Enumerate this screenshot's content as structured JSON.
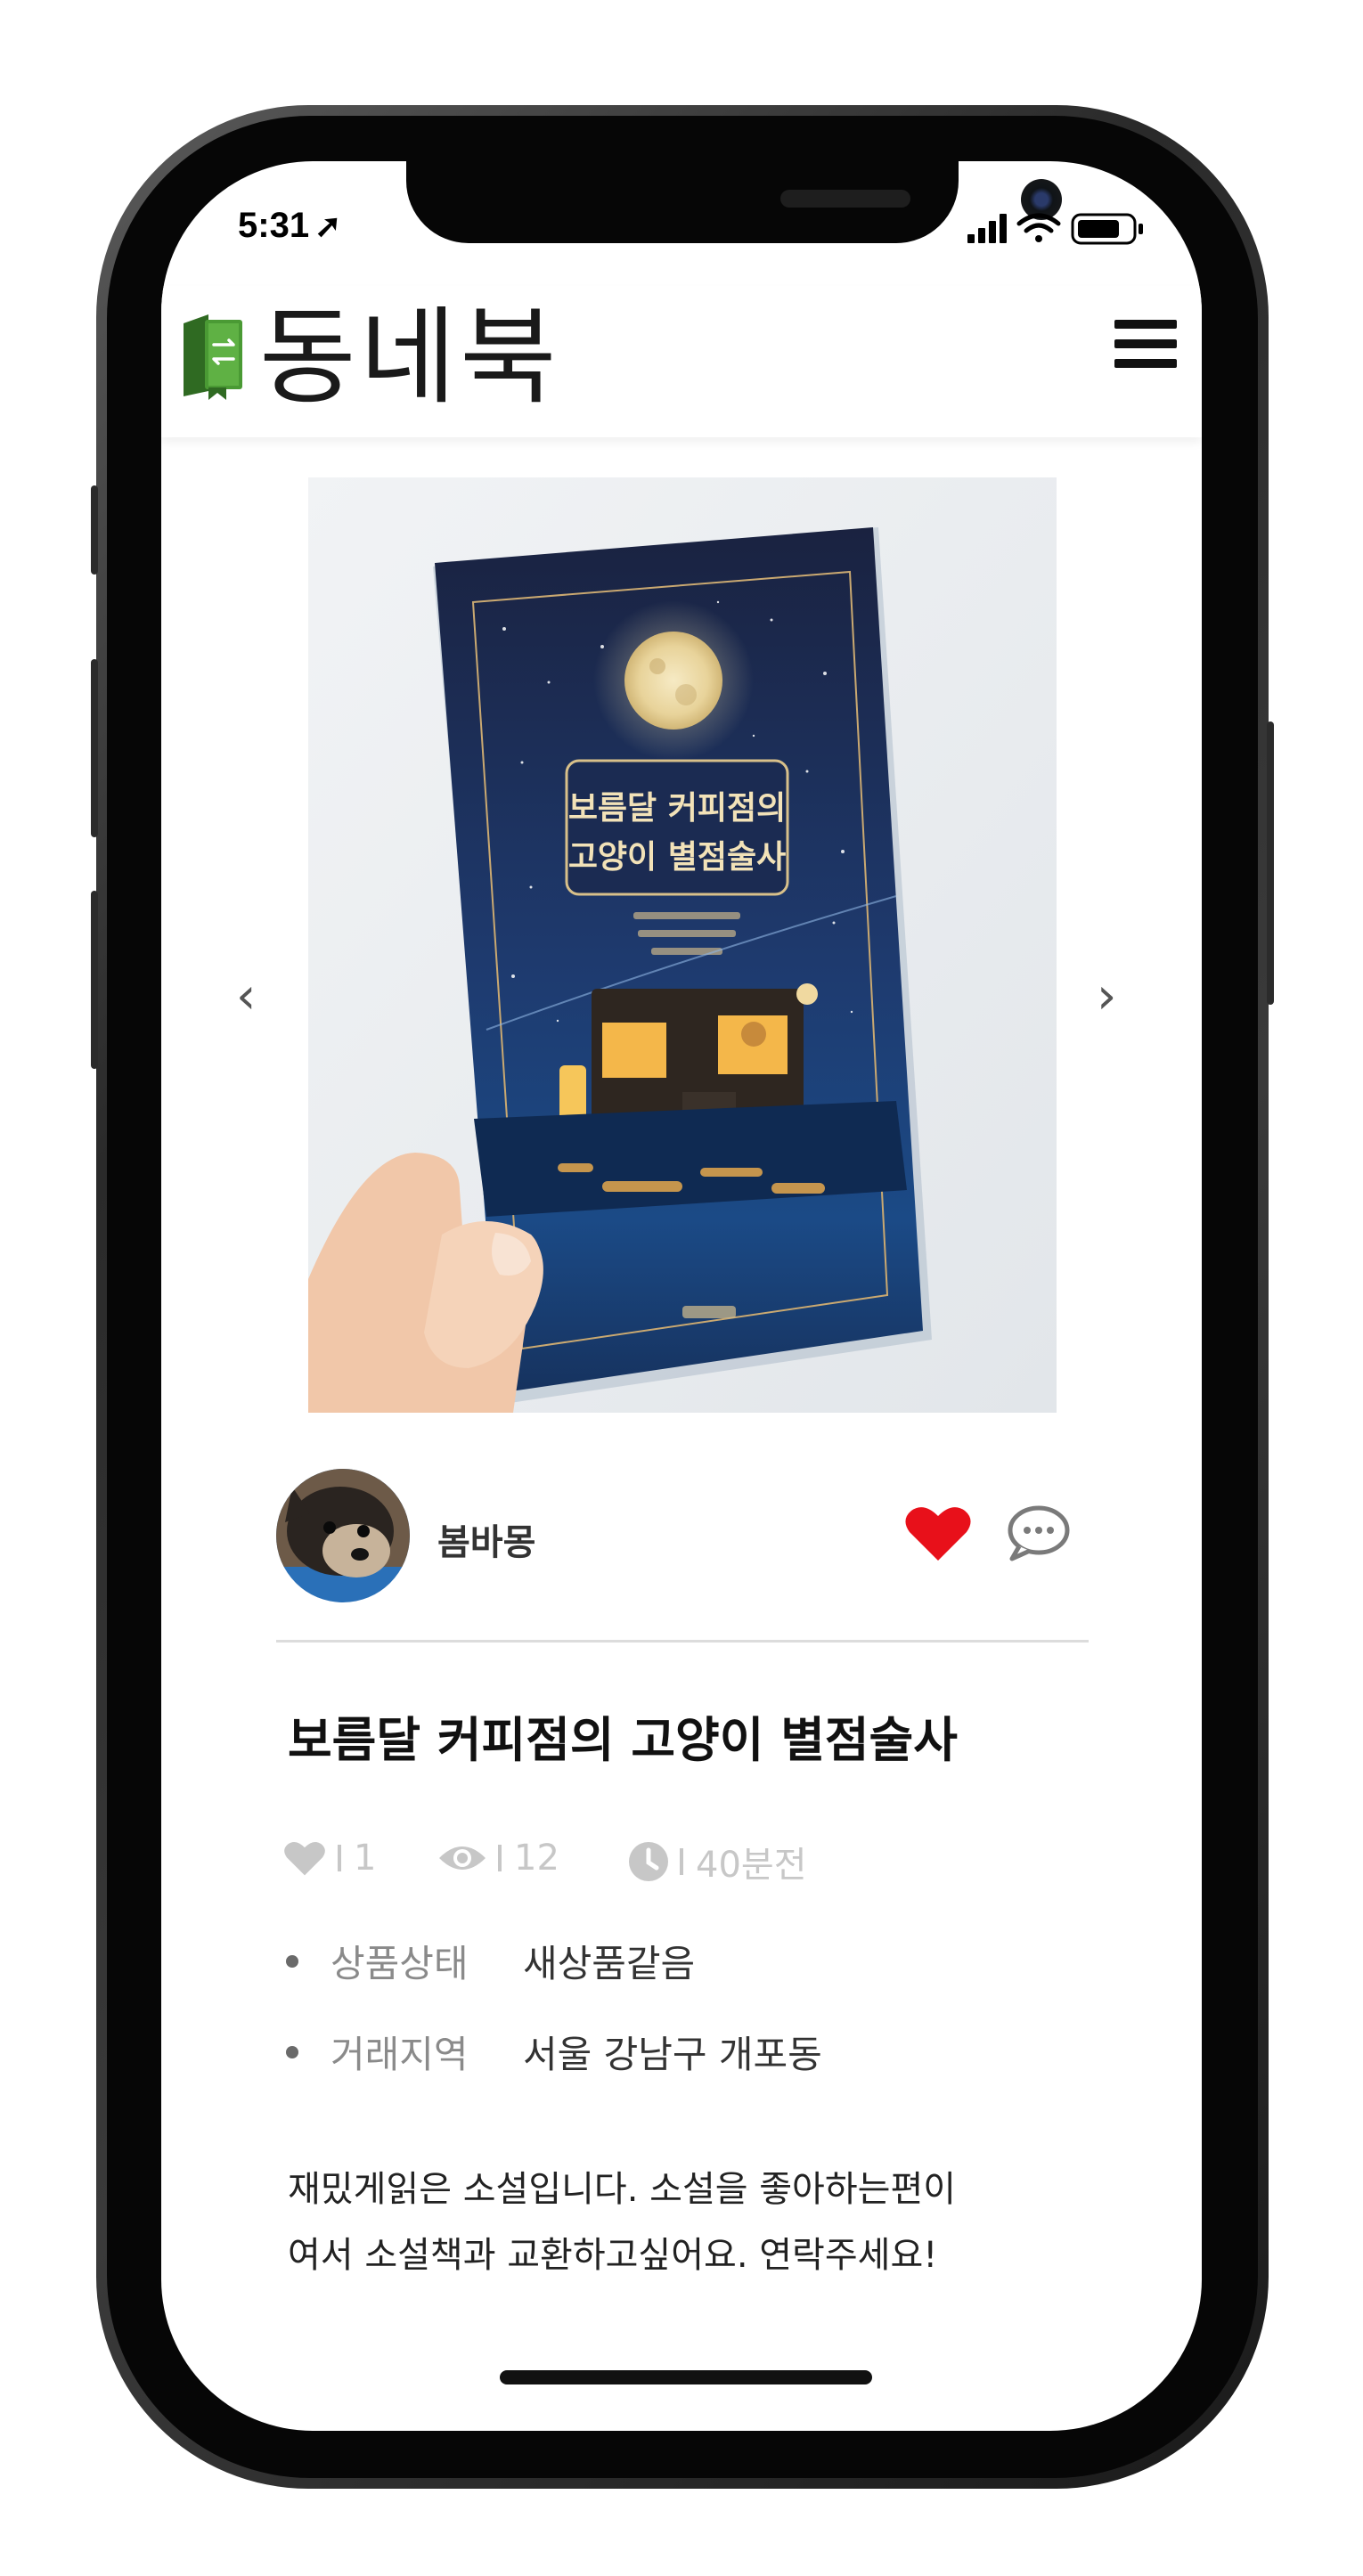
{
  "status_bar": {
    "time": "5:31",
    "location_glyph": "➚"
  },
  "header": {
    "logo_icon": "book-icon",
    "app_name": "동네북",
    "menu_icon": "hamburger-icon"
  },
  "carousel": {
    "prev_icon": "chevron-left-icon",
    "next_icon": "chevron-right-icon",
    "cover_title_line1": "보름달 커피점의",
    "cover_title_line2": "고양이 별점술사"
  },
  "seller": {
    "name": "봄바몽"
  },
  "product": {
    "title": "보름달 커피점의 고양이 별점술사",
    "likes": "1",
    "views": "12",
    "posted": "40분전"
  },
  "details": [
    {
      "label": "상품상태",
      "value": "새상품같음"
    },
    {
      "label": "거래지역",
      "value": "서울 강남구 개포동"
    }
  ],
  "description": {
    "line1": "재밌게읽은 소설입니다. 소설을 좋아하는편이",
    "line2": "여서 소설책과 교환하고싶어요. 연락주세요!"
  },
  "colors": {
    "accent_heart": "#e8101a",
    "logo_green": "#3f7d2a",
    "muted_stat": "#c7c7c7"
  }
}
